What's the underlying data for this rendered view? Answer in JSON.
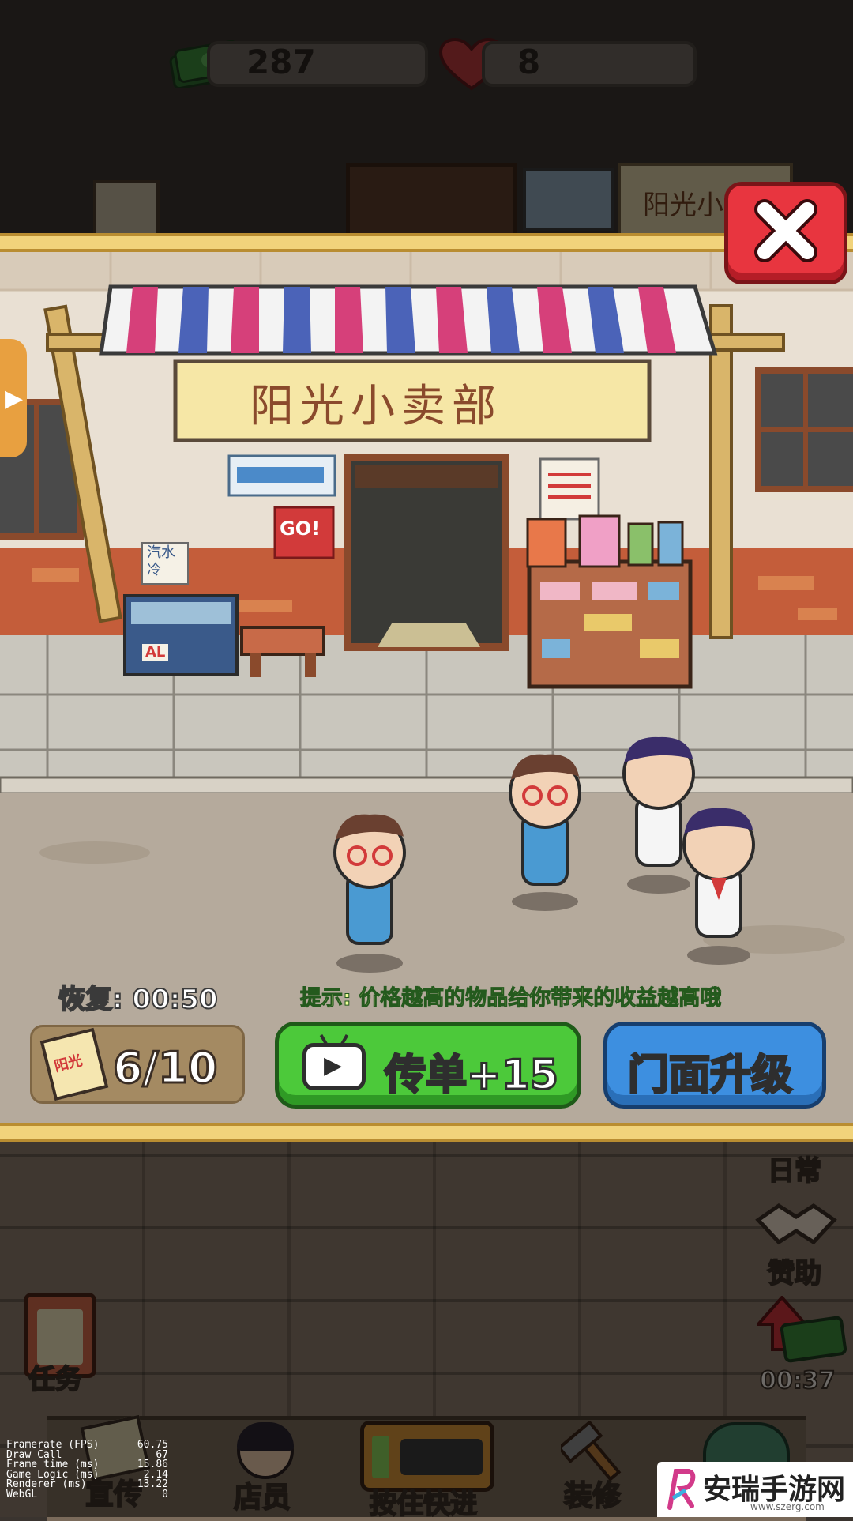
{
  "hud": {
    "cash": "287",
    "hearts": "8",
    "cash_icon": "cash-stack-icon",
    "heart_icon": "heart-icon"
  },
  "background_shop_sign": "阳光小",
  "modal": {
    "shop_sign": "阳光小卖部",
    "wall_signs": {
      "go": "GO!",
      "cold": "汽水\n冷",
      "al": "AL"
    },
    "recover_label": "恢复: 00:50",
    "tip_text": "提示: 价格越高的物品给你带来的收益越高哦",
    "flyer_icon_text": "阳光",
    "flyer_count": "6/10",
    "flyer_button": "传单+15",
    "upgrade_button": "门面升级",
    "close_icon": "close-icon"
  },
  "side_menu": {
    "daily": "日常",
    "sponsor": "赞助",
    "timer": "00:37"
  },
  "left_menu": {
    "task": "任务"
  },
  "bottom_nav": [
    "宣传",
    "店员",
    "按住快进",
    "装修"
  ],
  "debug": [
    {
      "k": "Framerate (FPS)",
      "v": "60.75"
    },
    {
      "k": "Draw Call",
      "v": "67"
    },
    {
      "k": "Frame time (ms)",
      "v": "15.86"
    },
    {
      "k": "Game Logic (ms)",
      "v": "2.14"
    },
    {
      "k": "Renderer (ms)",
      "v": "13.22"
    },
    {
      "k": "WebGL",
      "v": "0"
    }
  ],
  "watermark": {
    "title": "安瑞手游网",
    "url": "www.szerg.com"
  },
  "colors": {
    "green_button": "#4cc93a",
    "blue_button": "#3d8fe0",
    "close_red": "#e8353f",
    "frame_gold": "#f1d37b"
  }
}
